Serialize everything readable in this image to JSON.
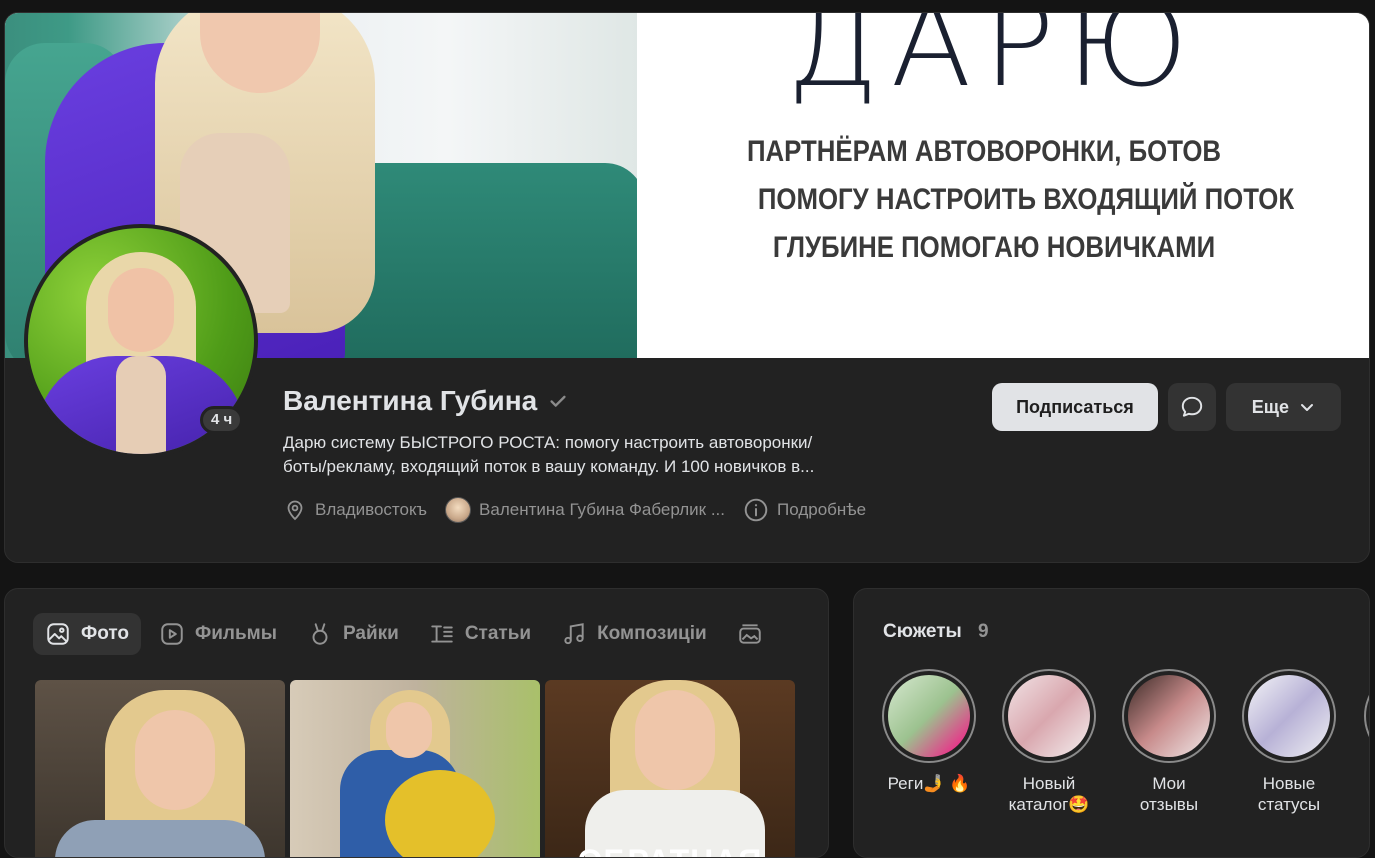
{
  "cover": {
    "headline": "ДАРЮ",
    "line1": "ПАРТНЁРАМ АВТОВОРОНКИ, БОТОВ",
    "line2": "ПОМОГУ НАСТРОИТЬ ВХОДЯЩИЙ ПОТОК",
    "line3": "ГЛУБИНЕ ПОМОГАЮ НОВИЧКАМИ"
  },
  "profile": {
    "avatar_time_badge": "4 ч",
    "name": "Валентина Губина",
    "bio_line1": "Дарю систему БЫСТРОГО РОСТА: помогу настроить автоворонки/",
    "bio_line2": "боты/рекламу, входящий поток в вашу команду. И 100 новичков в...",
    "location": "Владивостокъ",
    "community": "Валентина Губина Фаберлик ...",
    "details": "Подробнѣе",
    "verified_icon": "check-icon"
  },
  "actions": {
    "subscribe_label": "Подписаться",
    "more_label": "Еще"
  },
  "content_tabs": [
    {
      "label": "Фото",
      "icon": "photo-icon",
      "active": true
    },
    {
      "label": "Фильмы",
      "icon": "video-icon",
      "active": false
    },
    {
      "label": "Райки",
      "icon": "clip-icon",
      "active": false
    },
    {
      "label": "Статьи",
      "icon": "article-icon",
      "active": false
    },
    {
      "label": "Композиціи",
      "icon": "music-icon",
      "active": false
    }
  ],
  "photos": [
    {
      "caption": ""
    },
    {
      "caption": ""
    },
    {
      "caption": "ОБРАТНАЯ"
    }
  ],
  "stories": {
    "title": "Сюжеты",
    "count": "9",
    "items": [
      {
        "label_line1": "Реги🤳 🔥",
        "label_line2": ""
      },
      {
        "label_line1": "Новый",
        "label_line2": "каталог🤩"
      },
      {
        "label_line1": "Мои",
        "label_line2": "отзывы"
      },
      {
        "label_line1": "Новые",
        "label_line2": "статусы"
      }
    ]
  },
  "colors": {
    "background": "#141414",
    "card": "#222222",
    "text_primary": "#e1e3e6",
    "text_secondary": "#939393",
    "button_primary_bg": "#e1e3e6",
    "button_secondary_bg": "#333333"
  }
}
